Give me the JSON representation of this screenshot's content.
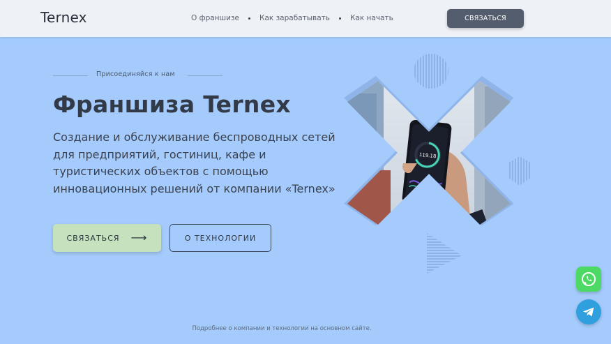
{
  "header": {
    "logo": "Ternex",
    "nav": [
      {
        "label": "О франшизе"
      },
      {
        "label": "Как зарабатывать"
      },
      {
        "label": "Как начать"
      }
    ],
    "contact_button": "СВЯЗАТЬСЯ"
  },
  "hero": {
    "kicker": "Присоединяйся к нам",
    "title": "Франшиза Ternex",
    "description_lines": [
      "Создание и обслуживание беспроводных сетей",
      "для предприятий, гостиниц, кафе и",
      "туристических объектов с помощью",
      "инновационных решений от компании «Ternex»"
    ],
    "primary_button": "СВЯЗАТЬСЯ",
    "secondary_button": "О ТЕХНОЛОГИИ",
    "phone_reading": "119.18"
  },
  "footer": {
    "note": "Подробнее о компании и технологии на основном сайте."
  },
  "floating": {
    "whatsapp_icon": "whatsapp-icon",
    "telegram_icon": "telegram-icon"
  },
  "colors": {
    "background": "#a4cbfc",
    "header_bg": "#eef1f6",
    "header_button": "#535d6d",
    "primary_button": "#c5e1be",
    "whatsapp": "#4cd964",
    "telegram": "#2f9fdd"
  }
}
